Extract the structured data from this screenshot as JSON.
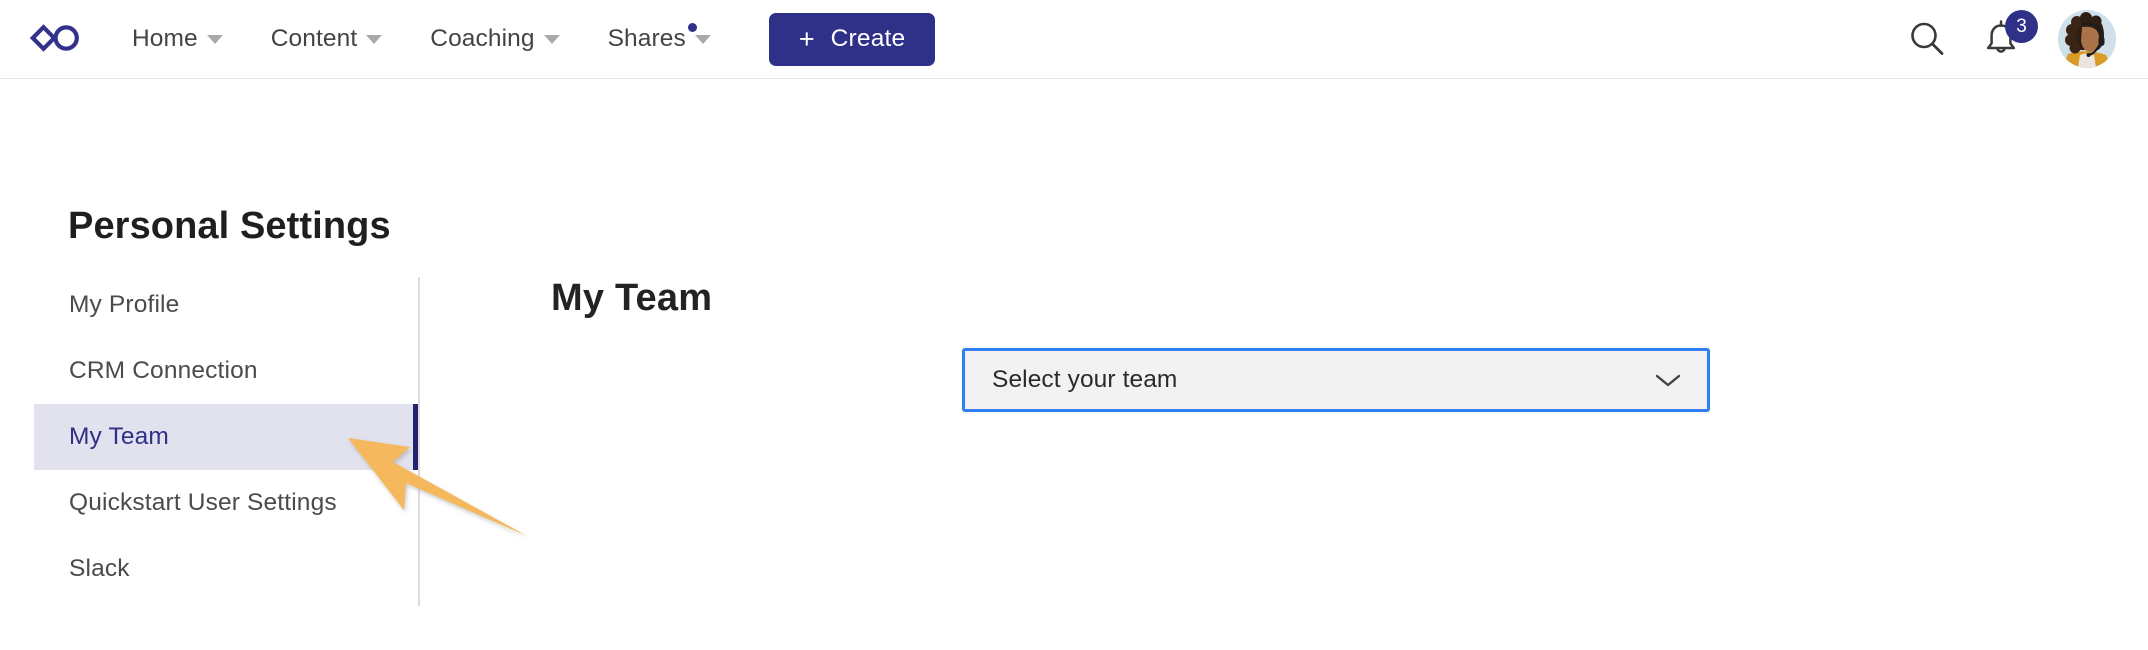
{
  "header": {
    "logo_icon": "infinity-logo-icon",
    "nav": [
      {
        "label": "Home",
        "has_caret": true,
        "has_dot": false
      },
      {
        "label": "Content",
        "has_caret": true,
        "has_dot": false
      },
      {
        "label": "Coaching",
        "has_caret": true,
        "has_dot": false
      },
      {
        "label": "Shares",
        "has_caret": true,
        "has_dot": true
      }
    ],
    "create_button": {
      "plus": "+",
      "label": "Create"
    },
    "search_icon": "search-icon",
    "bell_icon": "bell-icon",
    "notification_count": "3",
    "avatar_alt": "user-avatar"
  },
  "page": {
    "title": "Personal Settings"
  },
  "sidebar": {
    "items": [
      {
        "label": "My Profile",
        "active": false
      },
      {
        "label": "CRM Connection",
        "active": false
      },
      {
        "label": "My Team",
        "active": true
      },
      {
        "label": "Quickstart User Settings",
        "active": false
      },
      {
        "label": "Slack",
        "active": false
      }
    ]
  },
  "main": {
    "title": "My Team",
    "team_select": {
      "value": "Select your team",
      "placeholder": "Select your team",
      "chevron_icon": "chevron-down-icon",
      "focused": true
    }
  },
  "annotation": {
    "type": "arrow",
    "points_to": "sidebar-item-my-team",
    "color": "#F5B košer"
  },
  "colors": {
    "brand_navy": "#2F3088",
    "active_item_bg": "#E2E2EF",
    "active_indicator": "#22226D",
    "focus_blue": "#2F7FF0",
    "select_bg": "#F2F2F2",
    "annotation_orange": "#F5B959"
  }
}
